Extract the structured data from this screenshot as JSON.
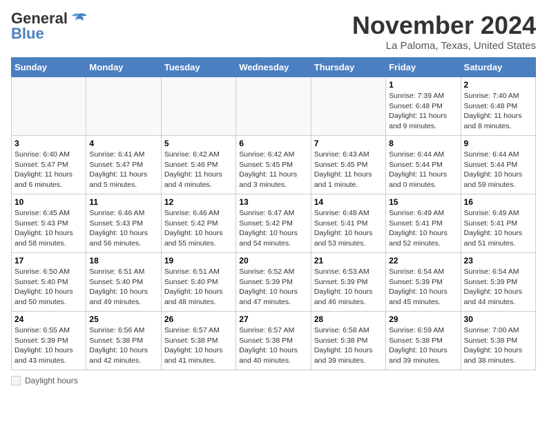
{
  "header": {
    "logo_general": "General",
    "logo_blue": "Blue",
    "month": "November 2024",
    "location": "La Paloma, Texas, United States"
  },
  "days_of_week": [
    "Sunday",
    "Monday",
    "Tuesday",
    "Wednesday",
    "Thursday",
    "Friday",
    "Saturday"
  ],
  "weeks": [
    [
      {
        "day": "",
        "info": ""
      },
      {
        "day": "",
        "info": ""
      },
      {
        "day": "",
        "info": ""
      },
      {
        "day": "",
        "info": ""
      },
      {
        "day": "",
        "info": ""
      },
      {
        "day": "1",
        "info": "Sunrise: 7:39 AM\nSunset: 6:48 PM\nDaylight: 11 hours and 9 minutes."
      },
      {
        "day": "2",
        "info": "Sunrise: 7:40 AM\nSunset: 6:48 PM\nDaylight: 11 hours and 8 minutes."
      }
    ],
    [
      {
        "day": "3",
        "info": "Sunrise: 6:40 AM\nSunset: 5:47 PM\nDaylight: 11 hours and 6 minutes."
      },
      {
        "day": "4",
        "info": "Sunrise: 6:41 AM\nSunset: 5:47 PM\nDaylight: 11 hours and 5 minutes."
      },
      {
        "day": "5",
        "info": "Sunrise: 6:42 AM\nSunset: 5:46 PM\nDaylight: 11 hours and 4 minutes."
      },
      {
        "day": "6",
        "info": "Sunrise: 6:42 AM\nSunset: 5:45 PM\nDaylight: 11 hours and 3 minutes."
      },
      {
        "day": "7",
        "info": "Sunrise: 6:43 AM\nSunset: 5:45 PM\nDaylight: 11 hours and 1 minute."
      },
      {
        "day": "8",
        "info": "Sunrise: 6:44 AM\nSunset: 5:44 PM\nDaylight: 11 hours and 0 minutes."
      },
      {
        "day": "9",
        "info": "Sunrise: 6:44 AM\nSunset: 5:44 PM\nDaylight: 10 hours and 59 minutes."
      }
    ],
    [
      {
        "day": "10",
        "info": "Sunrise: 6:45 AM\nSunset: 5:43 PM\nDaylight: 10 hours and 58 minutes."
      },
      {
        "day": "11",
        "info": "Sunrise: 6:46 AM\nSunset: 5:43 PM\nDaylight: 10 hours and 56 minutes."
      },
      {
        "day": "12",
        "info": "Sunrise: 6:46 AM\nSunset: 5:42 PM\nDaylight: 10 hours and 55 minutes."
      },
      {
        "day": "13",
        "info": "Sunrise: 6:47 AM\nSunset: 5:42 PM\nDaylight: 10 hours and 54 minutes."
      },
      {
        "day": "14",
        "info": "Sunrise: 6:48 AM\nSunset: 5:41 PM\nDaylight: 10 hours and 53 minutes."
      },
      {
        "day": "15",
        "info": "Sunrise: 6:49 AM\nSunset: 5:41 PM\nDaylight: 10 hours and 52 minutes."
      },
      {
        "day": "16",
        "info": "Sunrise: 6:49 AM\nSunset: 5:41 PM\nDaylight: 10 hours and 51 minutes."
      }
    ],
    [
      {
        "day": "17",
        "info": "Sunrise: 6:50 AM\nSunset: 5:40 PM\nDaylight: 10 hours and 50 minutes."
      },
      {
        "day": "18",
        "info": "Sunrise: 6:51 AM\nSunset: 5:40 PM\nDaylight: 10 hours and 49 minutes."
      },
      {
        "day": "19",
        "info": "Sunrise: 6:51 AM\nSunset: 5:40 PM\nDaylight: 10 hours and 48 minutes."
      },
      {
        "day": "20",
        "info": "Sunrise: 6:52 AM\nSunset: 5:39 PM\nDaylight: 10 hours and 47 minutes."
      },
      {
        "day": "21",
        "info": "Sunrise: 6:53 AM\nSunset: 5:39 PM\nDaylight: 10 hours and 46 minutes."
      },
      {
        "day": "22",
        "info": "Sunrise: 6:54 AM\nSunset: 5:39 PM\nDaylight: 10 hours and 45 minutes."
      },
      {
        "day": "23",
        "info": "Sunrise: 6:54 AM\nSunset: 5:39 PM\nDaylight: 10 hours and 44 minutes."
      }
    ],
    [
      {
        "day": "24",
        "info": "Sunrise: 6:55 AM\nSunset: 5:39 PM\nDaylight: 10 hours and 43 minutes."
      },
      {
        "day": "25",
        "info": "Sunrise: 6:56 AM\nSunset: 5:38 PM\nDaylight: 10 hours and 42 minutes."
      },
      {
        "day": "26",
        "info": "Sunrise: 6:57 AM\nSunset: 5:38 PM\nDaylight: 10 hours and 41 minutes."
      },
      {
        "day": "27",
        "info": "Sunrise: 6:57 AM\nSunset: 5:38 PM\nDaylight: 10 hours and 40 minutes."
      },
      {
        "day": "28",
        "info": "Sunrise: 6:58 AM\nSunset: 5:38 PM\nDaylight: 10 hours and 39 minutes."
      },
      {
        "day": "29",
        "info": "Sunrise: 6:59 AM\nSunset: 5:38 PM\nDaylight: 10 hours and 39 minutes."
      },
      {
        "day": "30",
        "info": "Sunrise: 7:00 AM\nSunset: 5:38 PM\nDaylight: 10 hours and 38 minutes."
      }
    ]
  ],
  "legend": {
    "box_label": "Daylight hours"
  }
}
